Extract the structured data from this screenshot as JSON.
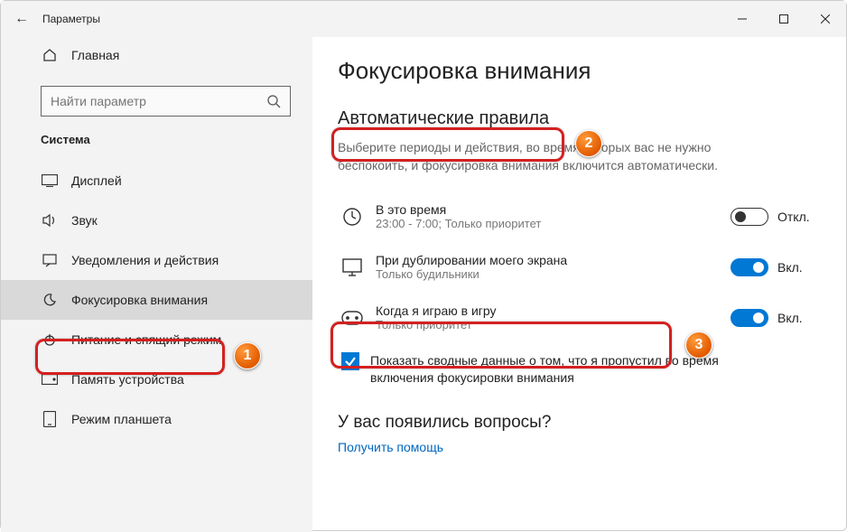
{
  "titlebar": {
    "back_icon": "←",
    "title": "Параметры"
  },
  "sidebar": {
    "home": "Главная",
    "search_placeholder": "Найти параметр",
    "category": "Система",
    "items": [
      {
        "label": "Дисплей"
      },
      {
        "label": "Звук"
      },
      {
        "label": "Уведомления и действия"
      },
      {
        "label": "Фокусировка внимания"
      },
      {
        "label": "Питание и спящий режим"
      },
      {
        "label": "Память устройства"
      },
      {
        "label": "Режим планшета"
      }
    ]
  },
  "page": {
    "title": "Фокусировка внимания",
    "section_title": "Автоматические правила",
    "section_desc": "Выберите периоды и действия, во время которых вас не нужно беспокоить, и фокусировка внимания включится автоматически.",
    "rules": [
      {
        "title": "В это время",
        "sub": "23:00 - 7:00; Только приоритет",
        "state": "Откл.",
        "on": false
      },
      {
        "title": "При дублировании моего экрана",
        "sub": "Только будильники",
        "state": "Вкл.",
        "on": true
      },
      {
        "title": "Когда я играю в игру",
        "sub": "Только приоритет",
        "state": "Вкл.",
        "on": true
      }
    ],
    "checkbox": "Показать сводные данные о том, что я пропустил во время включения фокусировки внимания",
    "questions_title": "У вас появились вопросы?",
    "help_link": "Получить помощь"
  },
  "annotations": {
    "b1": "1",
    "b2": "2",
    "b3": "3"
  }
}
